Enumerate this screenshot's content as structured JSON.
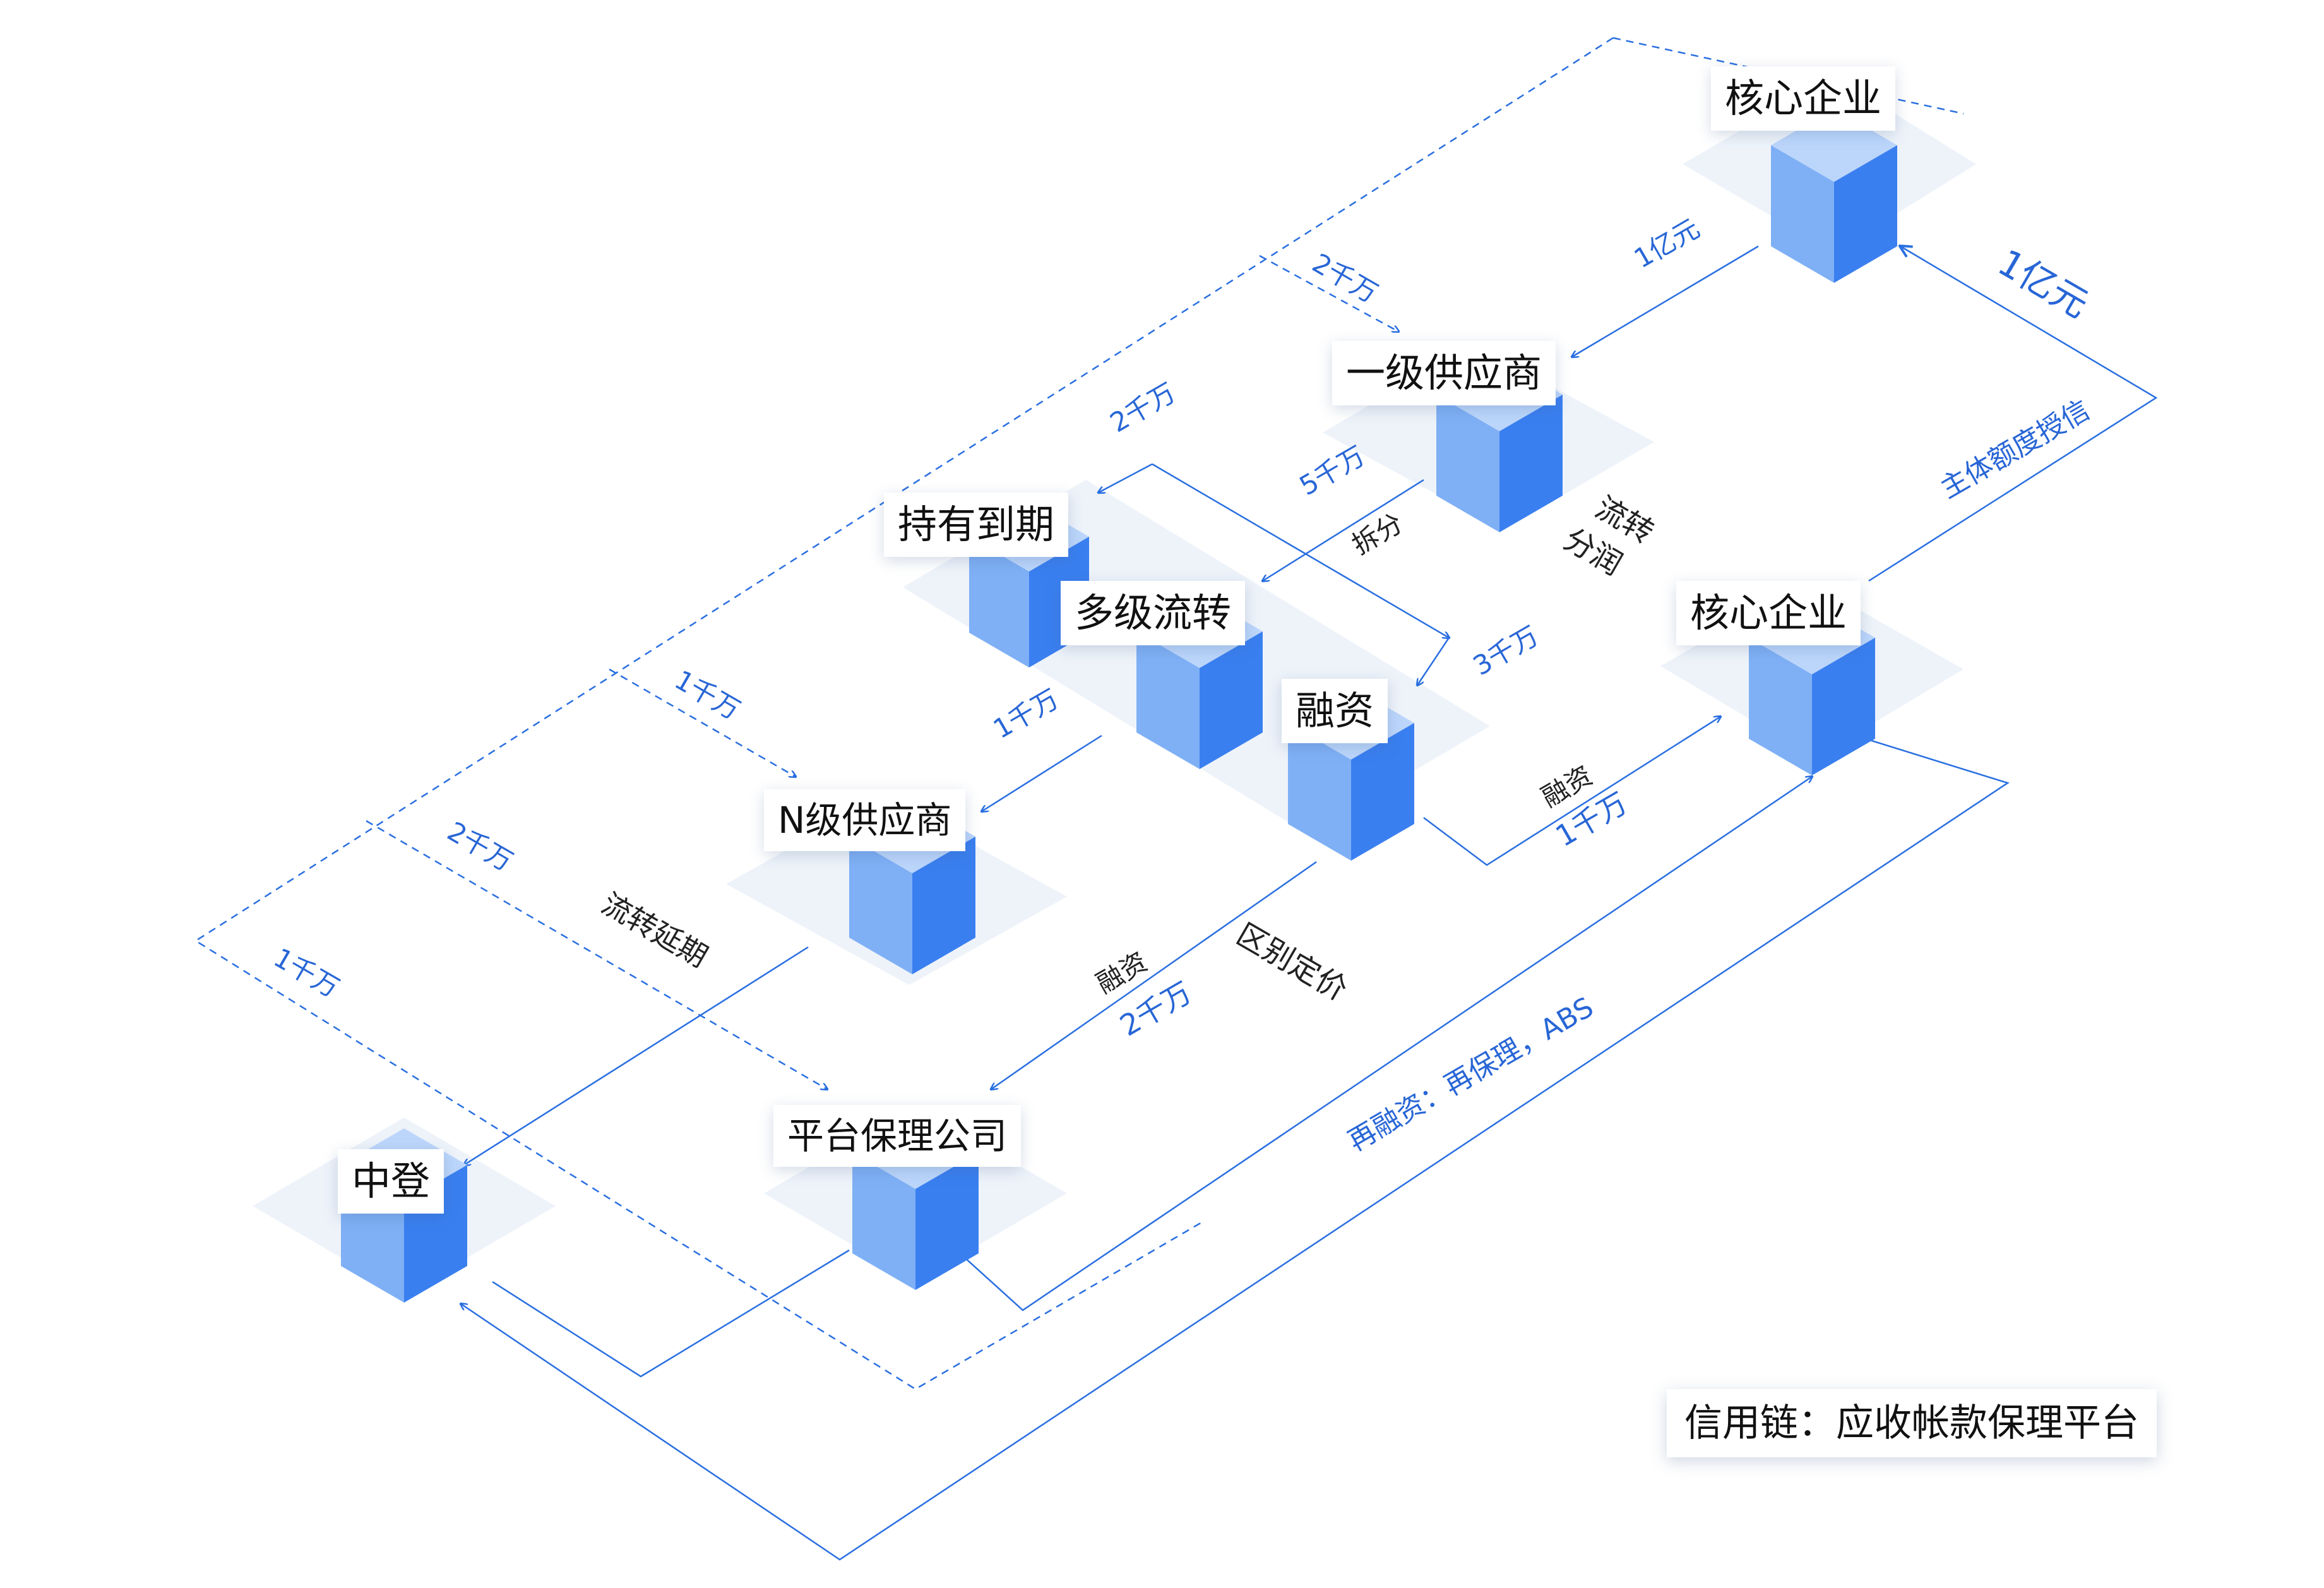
{
  "nodes": {
    "core_top": "核心企业",
    "tier1": "一级供应商",
    "hold": "持有到期",
    "multi": "多级流转",
    "finance": "融资",
    "nlevel": "N级供应商",
    "core_right": "核心企业",
    "platform": "平台保理公司",
    "zhongdeng": "中登"
  },
  "labels": {
    "yi_small": "1亿元",
    "yi_big": "1亿元",
    "credit": "主体额度授信",
    "qian2_a": "2千万",
    "qian2_b": "2千万",
    "qian5": "5千万",
    "split": "拆分",
    "circ_1": "流转",
    "circ_2": "分润",
    "qian3": "3千万",
    "qian1_a": "1千万",
    "qian1_b": "1千万",
    "fin_right": "融资",
    "qian1_right": "1千万",
    "qian2_c": "2千万",
    "extend": "流转延期",
    "qian1_c": "1千万",
    "fin_mid": "融资",
    "qian2_mid": "2千万",
    "pricing": "区别定价",
    "refinance": "再融资：再保理，ABS"
  },
  "caption": "信用链：应收帐款保理平台",
  "colors": {
    "line": "#2a6fe0",
    "cube_top": "#bcd6fb",
    "cube_left": "#7fb0f5",
    "cube_right": "#3a7ff0",
    "platform": "#eef3fa"
  }
}
